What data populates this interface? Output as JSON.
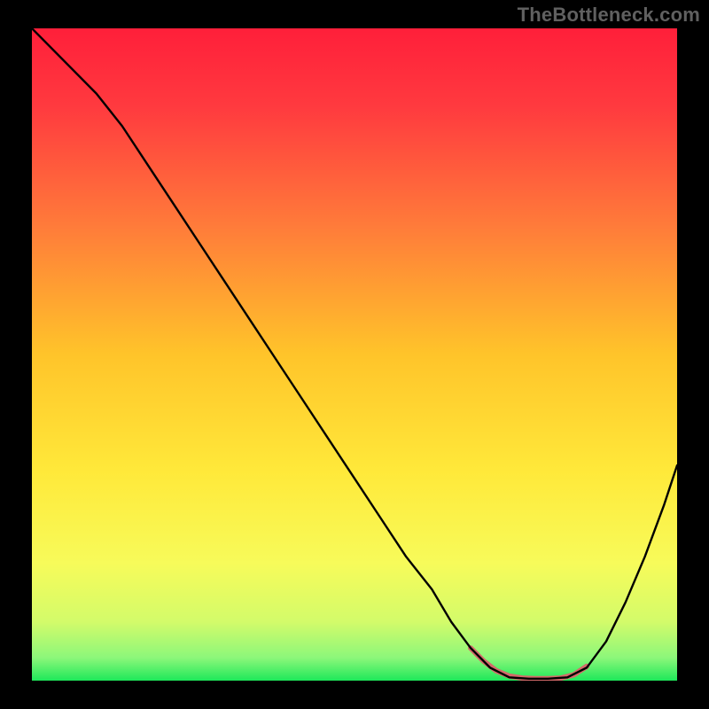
{
  "watermark": "TheBottleneck.com",
  "chart_data": {
    "type": "line",
    "title": "",
    "xlabel": "",
    "ylabel": "",
    "xlim": [
      0,
      100
    ],
    "ylim": [
      0,
      100
    ],
    "x": [
      0,
      2,
      6,
      10,
      14,
      18,
      22,
      26,
      30,
      34,
      38,
      42,
      46,
      50,
      54,
      58,
      62,
      65,
      68,
      71,
      74,
      77,
      80,
      83,
      86,
      89,
      92,
      95,
      98,
      100
    ],
    "y": [
      100,
      98,
      94,
      90,
      85,
      79,
      73,
      67,
      61,
      55,
      49,
      43,
      37,
      31,
      25,
      19,
      14,
      9,
      5,
      2,
      0.5,
      0.3,
      0.3,
      0.5,
      2,
      6,
      12,
      19,
      27,
      33
    ],
    "highlight": {
      "color": "#d46a6a",
      "thickness": 6,
      "x": [
        68,
        70,
        72,
        74,
        76,
        78,
        80,
        82,
        84,
        86
      ],
      "y": [
        5,
        3,
        1.5,
        0.7,
        0.4,
        0.3,
        0.3,
        0.4,
        0.9,
        2.2
      ]
    },
    "gradient_stops": [
      {
        "offset": 0.0,
        "color": "#ff1f3a"
      },
      {
        "offset": 0.12,
        "color": "#ff3a3f"
      },
      {
        "offset": 0.3,
        "color": "#ff7a3a"
      },
      {
        "offset": 0.5,
        "color": "#ffc42a"
      },
      {
        "offset": 0.68,
        "color": "#ffe93a"
      },
      {
        "offset": 0.82,
        "color": "#f7fb5a"
      },
      {
        "offset": 0.91,
        "color": "#d3fb6a"
      },
      {
        "offset": 0.965,
        "color": "#8cf77a"
      },
      {
        "offset": 1.0,
        "color": "#1ee85a"
      }
    ]
  }
}
